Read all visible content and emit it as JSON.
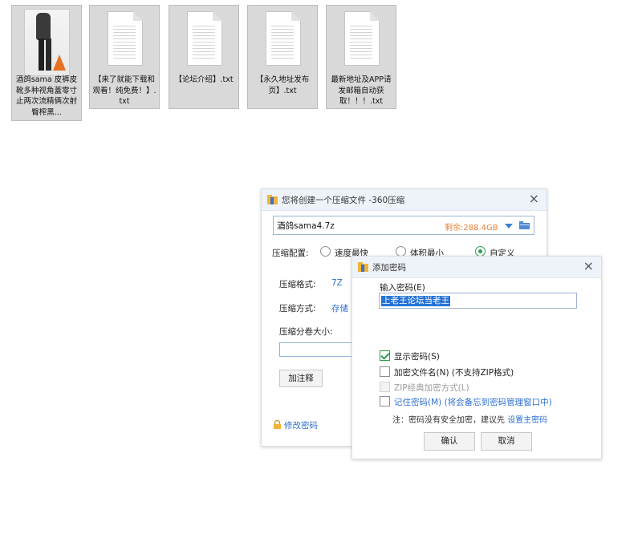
{
  "files": [
    {
      "name": "酒鸽sama  皮裤皮靴多种视角蓋零寸止两次流精俩次射臀榨黑...",
      "kind": "video"
    },
    {
      "name": "【来了就能下载和观看！纯免费！】.txt",
      "kind": "txt"
    },
    {
      "name": "【论坛介绍】.txt",
      "kind": "txt"
    },
    {
      "name": "【永久地址发布页】.txt",
      "kind": "txt"
    },
    {
      "name": "最新地址及APP请发邮箱自动获取！！！.txt",
      "kind": "txt"
    }
  ],
  "compress_dialog": {
    "title": "您将创建一个压缩文件 -360压缩",
    "filename": "酒鸽sama4.7z",
    "free_space": "剩余:288.4GB",
    "config_label": "压缩配置:",
    "radio_options": [
      "速度最快",
      "体积最小",
      "自定义"
    ],
    "selected_radio": "自定义",
    "format_label": "压缩格式:",
    "format_value": "7Z",
    "method_label": "压缩方式:",
    "method_value": "存储",
    "split_label": "压缩分卷大小:",
    "comment_button": "加注释",
    "change_password": "修改密码"
  },
  "password_dialog": {
    "title": "添加密码",
    "prompt": "输入密码(E)",
    "password": "上老王论坛当老王",
    "options": [
      {
        "label": "显示密码(S)",
        "checked": true,
        "disabled": false
      },
      {
        "label": "加密文件名(N) (不支持ZIP格式)",
        "checked": false,
        "disabled": false
      },
      {
        "label": "ZIP经典加密方式(L)",
        "checked": false,
        "disabled": true
      },
      {
        "label": "记住密码(M) (将会备忘到密码管理窗口中)",
        "checked": false,
        "disabled": false
      }
    ],
    "note_prefix": "注：密码没有安全加密，建议先",
    "note_link": "设置主密码",
    "ok_button": "确认",
    "cancel_button": "取消"
  },
  "colors": {
    "accent_blue": "#2c6fd1",
    "check_green": "#2d9c4f",
    "free_space_orange": "#e8833a",
    "selection_blue": "#2673d8",
    "title_bar": "#eef3f9"
  },
  "icons": [
    "folder-icon",
    "chevron-down-icon",
    "close-icon",
    "lock-icon",
    "archive-icon",
    "text-file-icon"
  ]
}
